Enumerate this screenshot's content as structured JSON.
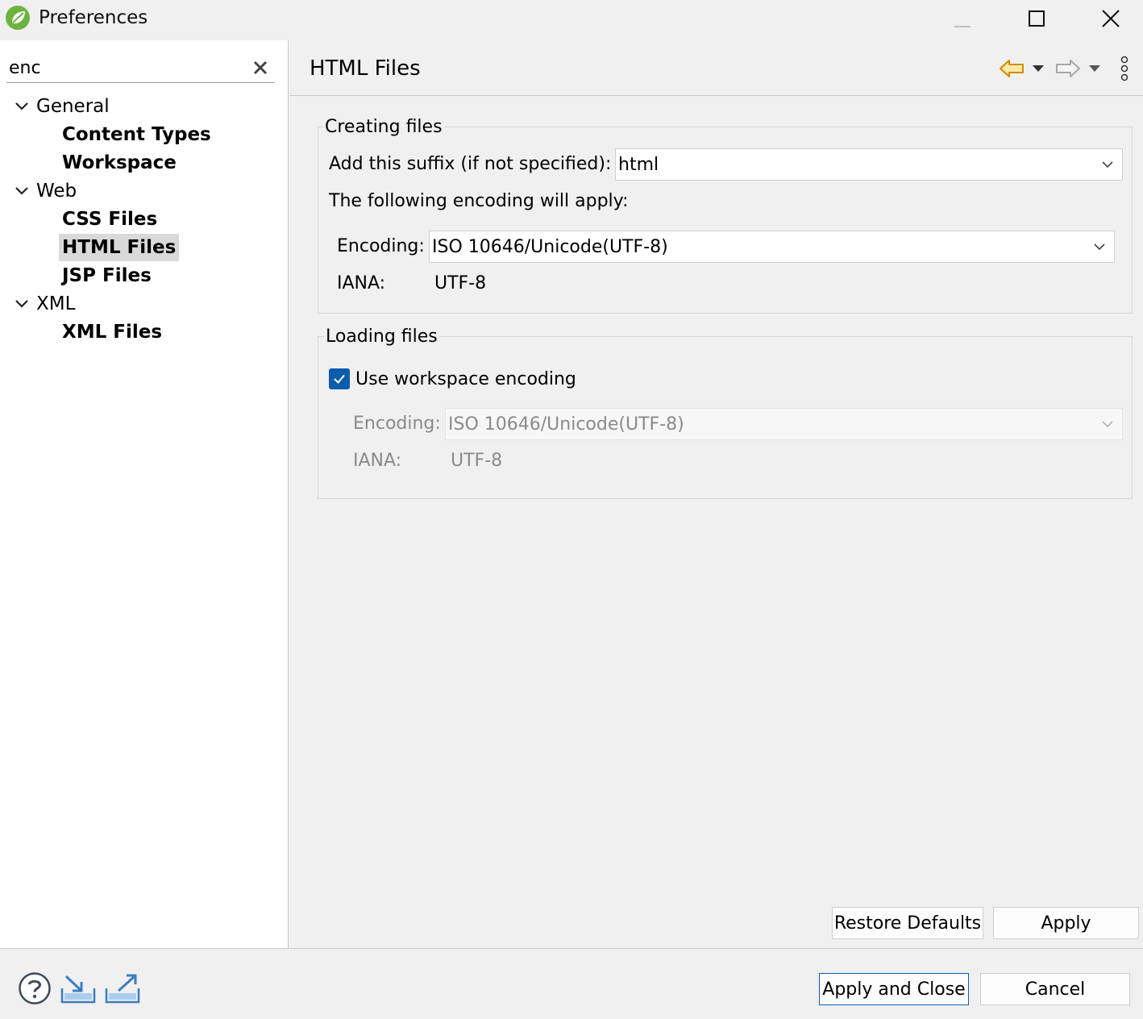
{
  "window": {
    "title": "Preferences"
  },
  "filter": {
    "value": "enc"
  },
  "tree": {
    "general": {
      "label": "General",
      "children": [
        "Content Types",
        "Workspace"
      ]
    },
    "web": {
      "label": "Web",
      "children": [
        "CSS Files",
        "HTML Files",
        "JSP Files"
      ]
    },
    "xml": {
      "label": "XML",
      "children": [
        "XML Files"
      ]
    },
    "selected": "HTML Files"
  },
  "page": {
    "title": "HTML Files",
    "creating": {
      "group_title": "Creating files",
      "suffix_label": "Add this suffix (if not specified):",
      "suffix_value": "html",
      "encoding_note": "The following encoding will apply:",
      "encoding_label": "Encoding:",
      "encoding_value": "ISO 10646/Unicode(UTF-8)",
      "iana_label": "IANA:",
      "iana_value": "UTF-8"
    },
    "loading": {
      "group_title": "Loading files",
      "checkbox_label": "Use workspace encoding",
      "checkbox_checked": true,
      "encoding_label": "Encoding:",
      "encoding_value": "ISO 10646/Unicode(UTF-8)",
      "iana_label": "IANA:",
      "iana_value": "UTF-8"
    },
    "restore_defaults": "Restore Defaults",
    "apply": "Apply"
  },
  "footer": {
    "apply_close": "Apply and Close",
    "cancel": "Cancel"
  },
  "colors": {
    "accent": "#0b5cad",
    "nav_back": "#d08a00",
    "selection": "#d9d9d9"
  }
}
